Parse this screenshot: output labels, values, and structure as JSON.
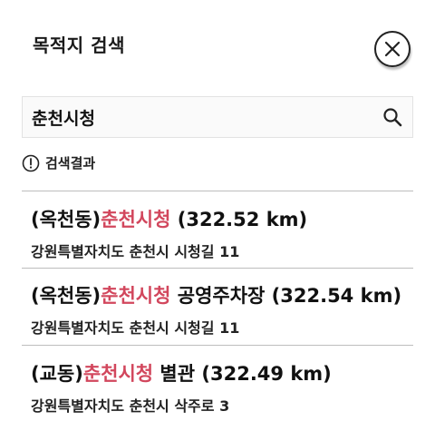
{
  "header": {
    "title": "목적지 검색"
  },
  "search": {
    "value": "춘천시청"
  },
  "results_label": "검색결과",
  "results": [
    {
      "prefix": "(옥천동)",
      "highlight": "춘천시청",
      "suffix": " (322.52 km)",
      "address": "강원특별자치도 춘천시 시청길 11"
    },
    {
      "prefix": "(옥천동)",
      "highlight": "춘천시청",
      "suffix": " 공영주차장 (322.54 km)",
      "address": "강원특별자치도 춘천시 시청길 11"
    },
    {
      "prefix": "(교동)",
      "highlight": "춘천시청",
      "suffix": " 별관 (322.49 km)",
      "address": "강원특별자치도 춘천시 삭주로 3"
    }
  ],
  "colors": {
    "highlight": "#d2475d",
    "text": "#111111",
    "divider": "#bdbdbd"
  }
}
